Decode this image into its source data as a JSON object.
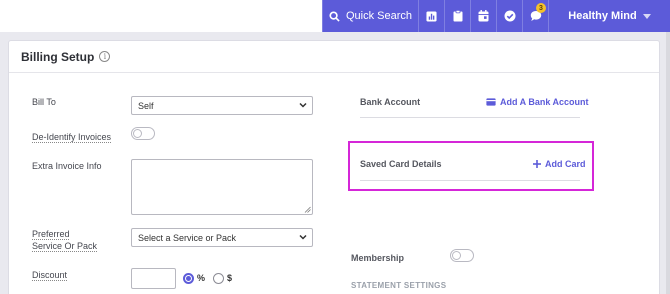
{
  "topbar": {
    "quick_search_label": "Quick Search",
    "user_name": "Healthy Mind",
    "notification_count": "3"
  },
  "colors": {
    "nav_bg": "#5c5bd9",
    "accent": "#5c5bd9",
    "highlight": "#d526d8"
  },
  "icons": [
    "search-icon",
    "report-icon",
    "clipboard-icon",
    "calendar-icon",
    "check-circle-icon",
    "chat-icon",
    "chevron-down-icon",
    "info-icon",
    "bank-card-icon",
    "plus-icon"
  ],
  "billing": {
    "title": "Billing Setup",
    "bill_to_label": "Bill To",
    "bill_to_value": "Self",
    "deidentify_label": "De-Identify Invoices",
    "extra_info_label": "Extra Invoice Info",
    "preferred_label_line1": "Preferred",
    "preferred_label_line2": "Service Or Pack",
    "preferred_placeholder": "Select a Service or Pack",
    "discount_label": "Discount",
    "discount_value": "",
    "percent_label": "%",
    "dollar_label": "$",
    "discount_type_selected": "%"
  },
  "right": {
    "bank_account_label": "Bank Account",
    "add_bank_account": "Add A Bank Account",
    "saved_card_label": "Saved Card Details",
    "add_card": "Add Card",
    "membership_label": "Membership",
    "statement_settings": "STATEMENT SETTINGS"
  }
}
